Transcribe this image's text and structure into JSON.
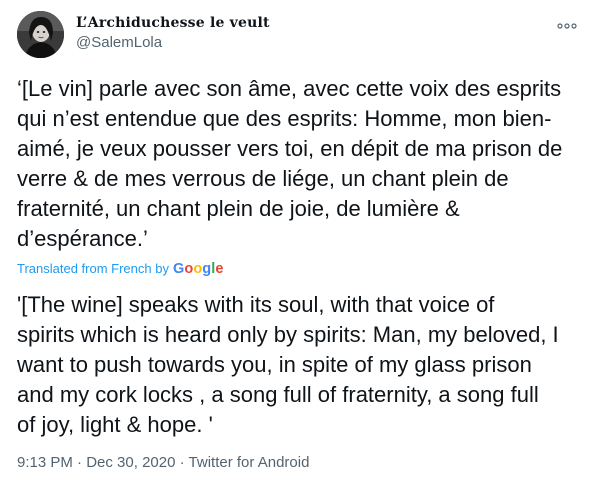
{
  "user": {
    "display_name": "L’Archiduchesse le veult",
    "handle": "@SalemLola",
    "avatar": "avatar-photo"
  },
  "menu": {
    "icon": "more-horizontal-icon"
  },
  "tweet": {
    "original_text": "‘[Le vin] parle avec son âme, avec cette voix des esprits\nqui n’est entendue que des esprits: Homme, mon bien-\naimé, je veux pousser vers toi, en dépit de ma prison de\nverre & de mes verrous de liége, un chant plein de\nfraternité, un chant plein de joie, de lumière &\nd’espérance.’",
    "translated_label": "Translated from French by",
    "translator": "Google",
    "translated_text": "'[The wine] speaks with its soul, with that voice of\nspirits which is heard only by spirits: Man, my beloved, I\nwant to push towards you, in spite of my glass prison\nand my cork locks , a song full of fraternity, a song full\nof joy, light & hope. '",
    "time": "9:13 PM",
    "separator": "·",
    "date": "Dec 30, 2020",
    "source": "Twitter for Android"
  },
  "colors": {
    "link_blue": "#1d9bf0",
    "google_blue": "#4285F4",
    "google_red": "#EA4335",
    "google_yellow": "#FBBC05",
    "google_green": "#34A853",
    "secondary_text": "#536471"
  }
}
